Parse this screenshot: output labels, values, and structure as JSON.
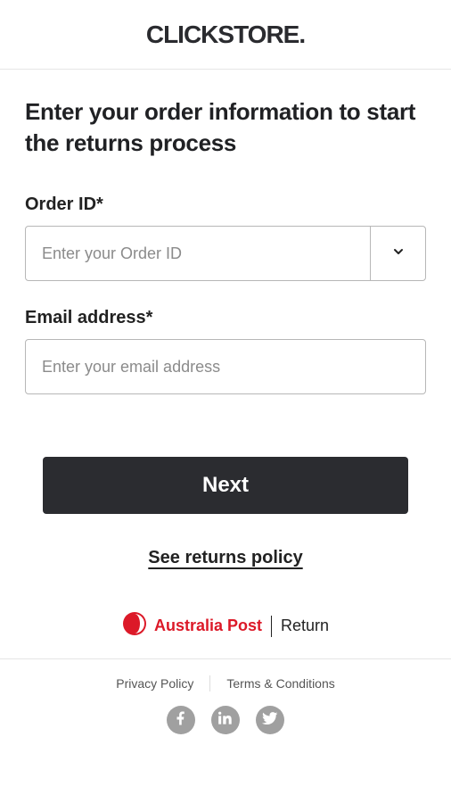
{
  "header": {
    "brand": "CLICKSTORE."
  },
  "form": {
    "title": "Enter your order information to start the returns process",
    "order_id": {
      "label": "Order ID*",
      "placeholder": "Enter your Order ID",
      "value": ""
    },
    "email": {
      "label": "Email address*",
      "placeholder": "Enter your email address",
      "value": ""
    }
  },
  "actions": {
    "next": "Next",
    "returns_policy": "See returns policy"
  },
  "branding": {
    "carrier": "Australia Post",
    "service": "Return"
  },
  "footer": {
    "privacy": "Privacy Policy",
    "terms": "Terms & Conditions"
  },
  "icons": {
    "chevron_down": "chevron-down-icon",
    "facebook": "facebook-icon",
    "linkedin": "linkedin-icon",
    "twitter": "twitter-icon",
    "auspost": "auspost-logo-icon"
  }
}
